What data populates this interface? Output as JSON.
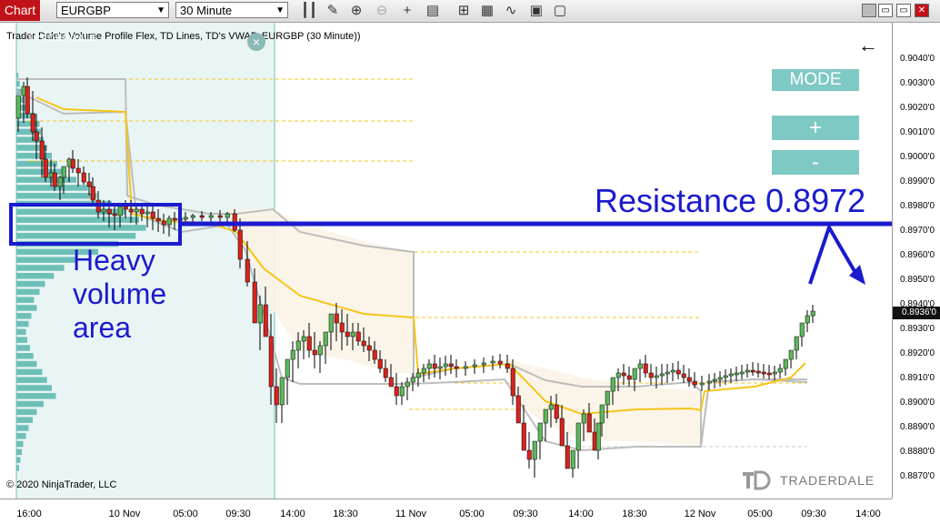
{
  "toolbar": {
    "chart_tab": "Chart",
    "instrument": "EURGBP",
    "timeframe": "30 Minute",
    "buttons": [
      "bars-icon",
      "pencil-icon",
      "zoom-in-icon",
      "zoom-out-icon",
      "crosshair-icon",
      "properties-icon",
      "data-box-icon",
      "strategy-icon",
      "indicators-icon",
      "templates-icon",
      "attach-icon"
    ]
  },
  "chart": {
    "label": "Trader Dale's Volume Profile Flex, TD Lines, TD's VWAP, EURGBP (30 Minute))",
    "copyright": "© 2020 NinjaTrader, LLC",
    "profile_logo": "TRADERDALE",
    "close_symbol": "×",
    "back_symbol": "←",
    "mode_label": "MODE",
    "plus_label": "+",
    "minus_label": "-",
    "resistance_label": "Resistance 0.8972",
    "heavy_label": [
      "Heavy",
      "volume",
      "area"
    ],
    "brand": "TRADERDALE",
    "current_price": "0.8936'0",
    "price_ticks": [
      "0.9040'0",
      "0.9030'0",
      "0.9020'0",
      "0.9010'0",
      "0.9000'0",
      "0.8990'0",
      "0.8980'0",
      "0.8970'0",
      "0.8960'0",
      "0.8950'0",
      "0.8940'0",
      "0.8930'0",
      "0.8920'0",
      "0.8910'0",
      "0.8900'0",
      "0.8890'0",
      "0.8880'0",
      "0.8870'0"
    ],
    "time_ticks": [
      "16:00",
      "10 Nov",
      "05:00",
      "09:30",
      "14:00",
      "18:30",
      "11 Nov",
      "05:00",
      "09:30",
      "14:00",
      "18:30",
      "12 Nov",
      "05:00",
      "09:30",
      "14:00"
    ],
    "colors": {
      "bull": "#5cb85c",
      "bear": "#d9231e",
      "annotation": "#1a1acf",
      "vwap": "#f5c518",
      "band": "#c0c0c0",
      "profile": "#6fbfb9"
    }
  }
}
